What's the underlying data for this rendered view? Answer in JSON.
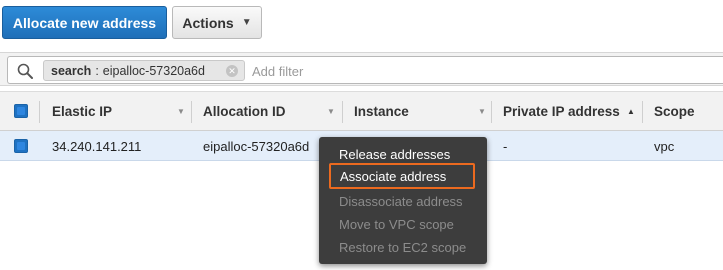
{
  "toolbar": {
    "allocate_label": "Allocate new address",
    "actions_label": "Actions"
  },
  "search": {
    "token_key": "search",
    "token_sep": ":",
    "token_value": "eipalloc-57320a6d",
    "placeholder": "Add filter"
  },
  "table": {
    "columns": [
      "Elastic IP",
      "Allocation ID",
      "Instance",
      "Private IP address",
      "Scope"
    ],
    "rows": [
      {
        "elastic_ip": "34.240.141.211",
        "allocation_id": "eipalloc-57320a6d",
        "instance": "",
        "private_ip": "-",
        "scope": "vpc",
        "selected": true
      }
    ]
  },
  "context_menu": {
    "items": [
      {
        "label": "Release addresses",
        "enabled": true,
        "highlighted": false
      },
      {
        "label": "Associate address",
        "enabled": true,
        "highlighted": true
      },
      {
        "label": "Disassociate address",
        "enabled": false,
        "highlighted": false
      },
      {
        "label": "Move to VPC scope",
        "enabled": false,
        "highlighted": false
      },
      {
        "label": "Restore to EC2 scope",
        "enabled": false,
        "highlighted": false
      }
    ]
  },
  "icons": {
    "search": "search-icon",
    "token_close": "close-icon",
    "actions_caret": "chevron-down-icon",
    "sort_desc": "sort-down-icon",
    "sort_asc": "sort-up-icon"
  },
  "colors": {
    "primary_button": "#1f6fb8",
    "selected_row": "#e4eefa",
    "menu_background": "#3d3d3d",
    "highlight_border": "#ec6a1f"
  }
}
